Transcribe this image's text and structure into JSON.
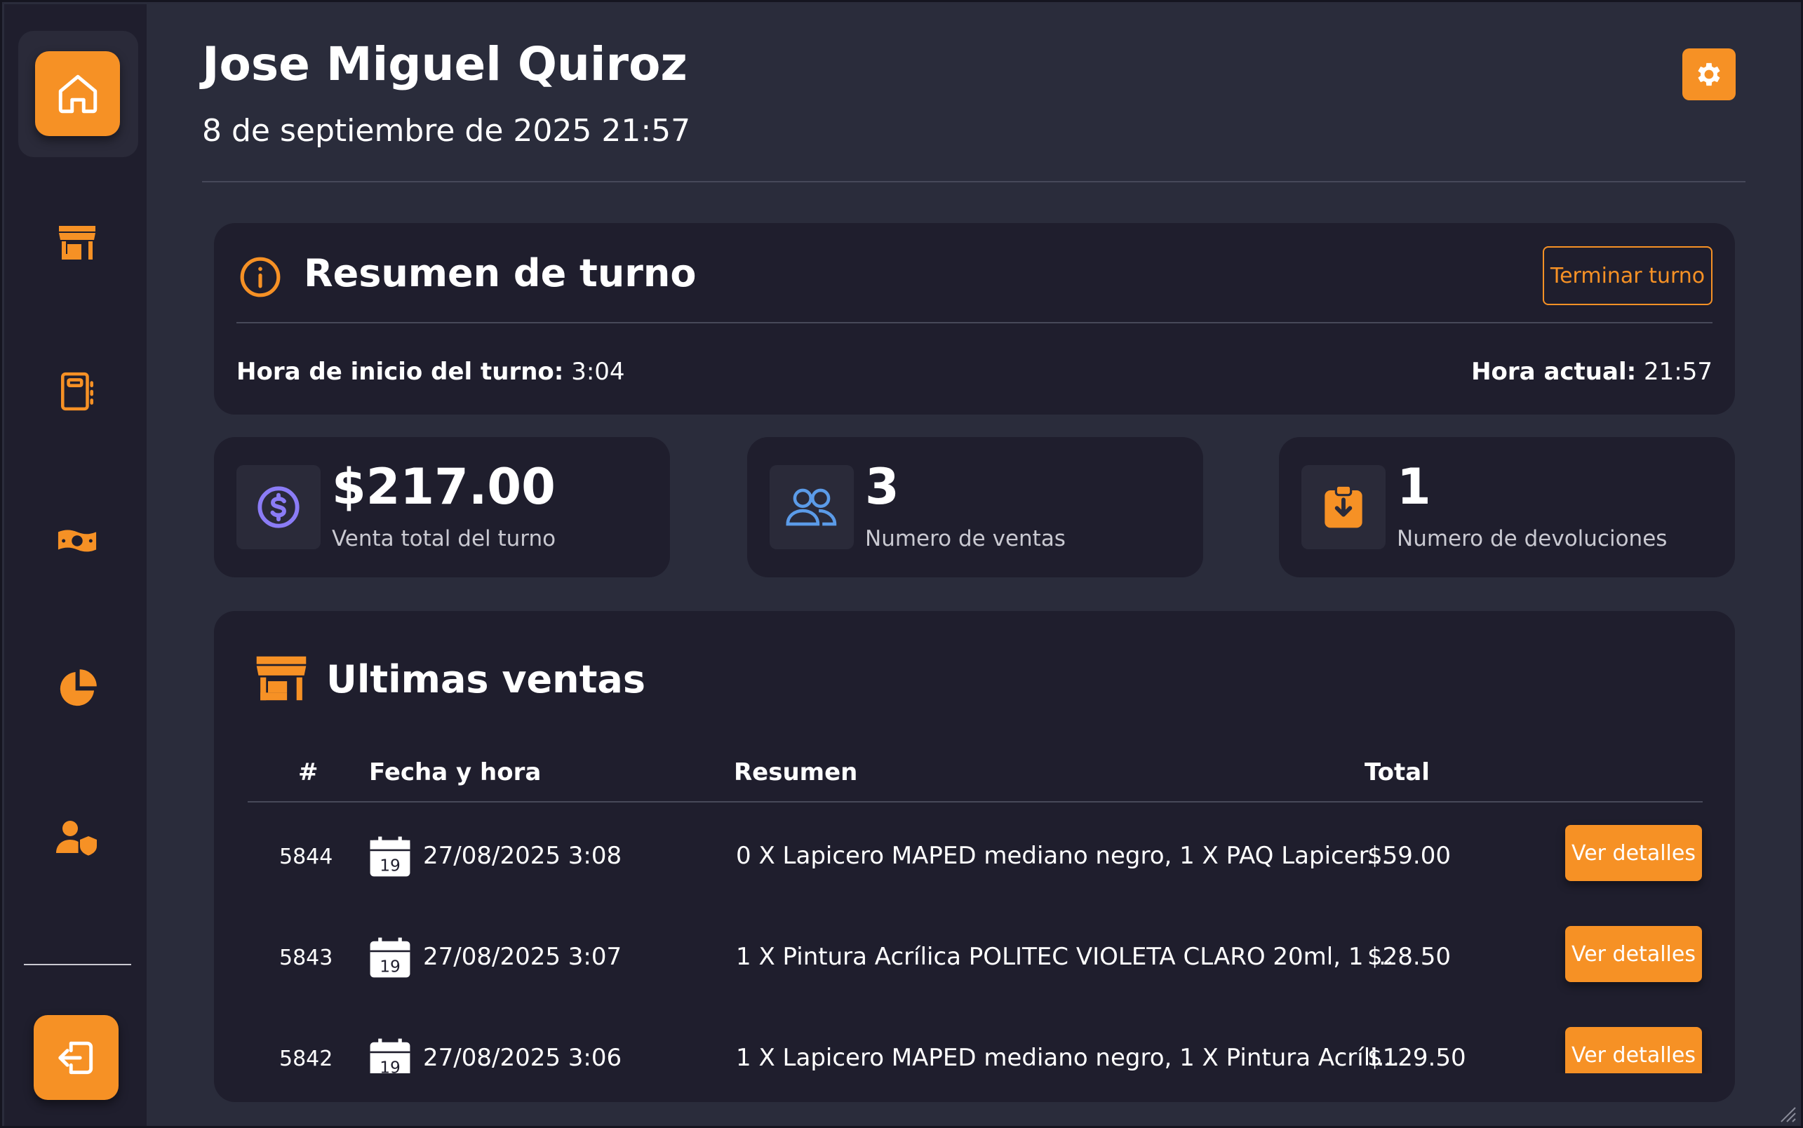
{
  "header": {
    "user_name": "Jose Miguel Quiroz",
    "datetime": "8 de septiembre de 2025 21:57"
  },
  "sidebar": {
    "items": [
      {
        "icon": "home-icon",
        "active": true
      },
      {
        "icon": "store-icon"
      },
      {
        "icon": "notebook-icon"
      },
      {
        "icon": "money-icon"
      },
      {
        "icon": "pie-chart-icon"
      },
      {
        "icon": "user-shield-icon"
      }
    ],
    "logout_icon": "logout-icon"
  },
  "summary": {
    "title": "Resumen de turno",
    "end_button": "Terminar turno",
    "start_label": "Hora de inicio del turno:",
    "start_value": "3:04",
    "current_label": "Hora actual:",
    "current_value": "21:57"
  },
  "stats": [
    {
      "value": "$217.00",
      "label": "Venta total del turno",
      "icon": "dollar-icon",
      "color": "#8b7cf6"
    },
    {
      "value": "3",
      "label": "Numero de ventas",
      "icon": "users-icon",
      "color": "#5b9be8"
    },
    {
      "value": "1",
      "label": "Numero de devoluciones",
      "icon": "return-icon",
      "color": "#f69125"
    }
  ],
  "sales": {
    "title": "Ultimas ventas",
    "columns": [
      "#",
      "Fecha y hora",
      "Resumen",
      "Total"
    ],
    "calendar_day": "19",
    "detail_button": "Ver detalles",
    "rows": [
      {
        "id": "5844",
        "datetime": "27/08/2025 3:08",
        "summary": "0 X Lapicero MAPED mediano negro, 1 X PAQ Lapicer...",
        "total": "$59.00"
      },
      {
        "id": "5843",
        "datetime": "27/08/2025 3:07",
        "summary": "1 X Pintura Acrílica POLITEC VIOLETA CLARO 20ml, 1 ...",
        "total": "$28.50"
      },
      {
        "id": "5842",
        "datetime": "27/08/2025 3:06",
        "summary": "1 X Lapicero MAPED mediano negro, 1 X Pintura Acríli...",
        "total": "$129.50"
      }
    ]
  },
  "colors": {
    "accent": "#f69125",
    "background": "#2a2c3b",
    "card": "#1f1e2d"
  }
}
